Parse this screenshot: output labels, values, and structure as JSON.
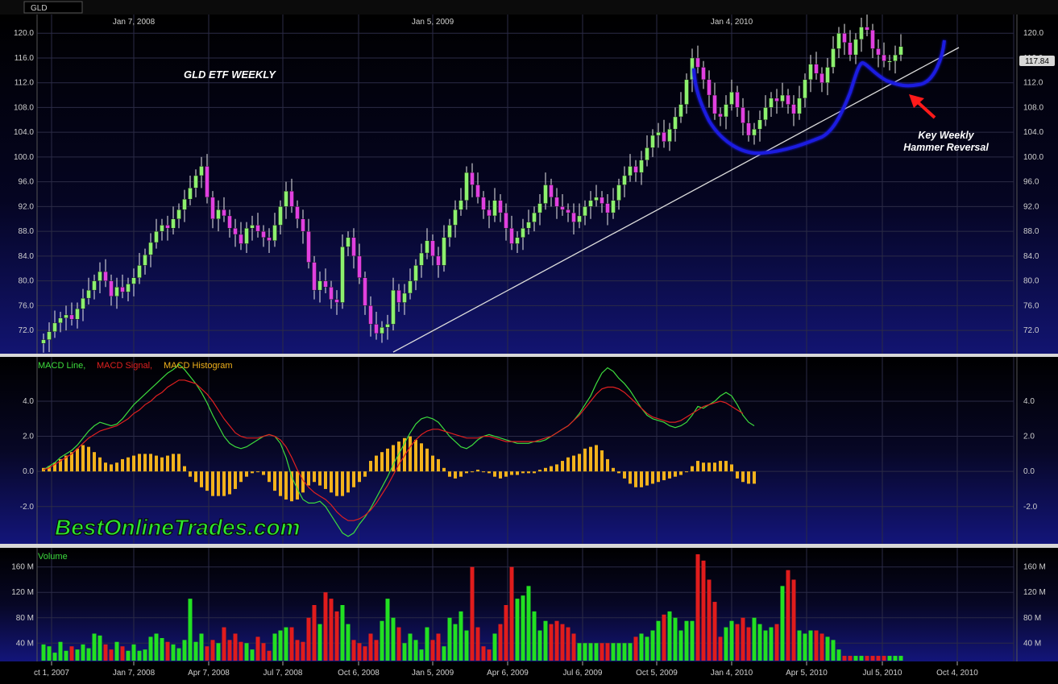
{
  "header": {
    "symbol": "GLD"
  },
  "chart_data": [
    {
      "type": "candlestick",
      "title": "GLD ETF WEEKLY",
      "top_date_labels": [
        "Jan 7, 2008",
        "Jan 5, 2009",
        "Jan 4, 2010"
      ],
      "ylim": [
        68.5,
        122.5
      ],
      "yticks": [
        72.0,
        76.0,
        80.0,
        84.0,
        88.0,
        92.0,
        96.0,
        100.0,
        104.0,
        108.0,
        112.0,
        116.0,
        120.0
      ],
      "last_price_label": "117.84",
      "annotation": [
        "Key Weekly",
        "Hammer Reversal"
      ],
      "grid": true,
      "closes": [
        70.5,
        71.8,
        73.2,
        74.0,
        74.5,
        73.8,
        75.5,
        77.2,
        78.5,
        80.0,
        81.5,
        80.0,
        77.5,
        79.0,
        78.2,
        79.5,
        80.5,
        82.5,
        84.2,
        86.2,
        88.0,
        89.0,
        88.5,
        90.0,
        91.5,
        93.2,
        95.0,
        97.0,
        98.5,
        93.5,
        90.0,
        91.5,
        90.5,
        88.5,
        87.5,
        86.0,
        88.5,
        89.0,
        88.0,
        87.0,
        86.5,
        89.0,
        92.0,
        94.5,
        92.0,
        90.0,
        88.0,
        83.0,
        78.5,
        80.0,
        79.0,
        77.0,
        76.5,
        85.5,
        87.0,
        84.0,
        80.5,
        76.0,
        73.0,
        71.5,
        72.5,
        73.0,
        78.5,
        76.5,
        78.0,
        80.0,
        82.5,
        84.5,
        86.5,
        84.0,
        82.5,
        87.0,
        89.0,
        91.5,
        93.0,
        97.5,
        95.5,
        93.5,
        91.5,
        90.5,
        93.0,
        91.0,
        88.5,
        86.0,
        87.0,
        88.5,
        89.5,
        91.0,
        92.5,
        95.5,
        93.5,
        92.0,
        91.5,
        91.0,
        89.5,
        90.5,
        92.0,
        93.0,
        93.5,
        92.5,
        91.0,
        93.0,
        95.5,
        97.0,
        98.5,
        97.5,
        99.5,
        101.5,
        103.5,
        104.0,
        102.5,
        104.5,
        106.5,
        108.5,
        112.5,
        116.0,
        114.5,
        112.5,
        110.0,
        107.0,
        106.5,
        108.5,
        110.5,
        108.0,
        105.5,
        103.5,
        104.5,
        106.0,
        108.0,
        109.5,
        109.0,
        110.0,
        108.5,
        107.0,
        109.5,
        112.5,
        115.0,
        113.5,
        112.0,
        114.5,
        117.5,
        120.0,
        118.5,
        116.5,
        119.0,
        121.0,
        120.5,
        117.5,
        116.5,
        115.5,
        115.5,
        116.5,
        117.84
      ]
    },
    {
      "type": "line",
      "series": [
        {
          "name": "MACD Line",
          "color": "#3ddc3d",
          "values": [
            0.1,
            0.3,
            0.5,
            0.8,
            1.0,
            1.2,
            1.5,
            1.9,
            2.3,
            2.6,
            2.8,
            2.7,
            2.6,
            2.7,
            3.0,
            3.4,
            3.8,
            4.1,
            4.4,
            4.7,
            5.0,
            5.3,
            5.6,
            5.8,
            6.1,
            5.8,
            5.4,
            5.0,
            4.5,
            3.9,
            3.2,
            2.6,
            2.0,
            1.6,
            1.4,
            1.3,
            1.4,
            1.6,
            1.8,
            2.0,
            2.1,
            2.0,
            1.6,
            0.8,
            -0.3,
            -1.0,
            -1.6,
            -1.8,
            -1.8,
            -1.7,
            -2.0,
            -2.5,
            -3.0,
            -3.5,
            -3.7,
            -3.5,
            -3.0,
            -2.6,
            -2.1,
            -1.5,
            -0.9,
            -0.3,
            0.4,
            1.0,
            1.6,
            2.2,
            2.7,
            3.0,
            3.1,
            3.0,
            2.8,
            2.4,
            2.0,
            1.7,
            1.4,
            1.3,
            1.5,
            1.8,
            2.0,
            2.1,
            2.0,
            1.9,
            1.8,
            1.7,
            1.6,
            1.6,
            1.6,
            1.7,
            1.7,
            1.8,
            2.0,
            2.2,
            2.4,
            2.6,
            2.9,
            3.3,
            3.8,
            4.3,
            5.0,
            5.6,
            5.9,
            5.7,
            5.3,
            5.0,
            4.6,
            4.1,
            3.6,
            3.2,
            3.0,
            2.9,
            2.8,
            2.6,
            2.5,
            2.6,
            2.8,
            3.2,
            3.7,
            3.6,
            3.8,
            4.0,
            4.3,
            4.5,
            4.3,
            3.8,
            3.2,
            2.8,
            2.6
          ]
        },
        {
          "name": "MACD Signal",
          "color": "#e02020",
          "values": [
            0.1,
            0.2,
            0.4,
            0.6,
            0.8,
            1.0,
            1.3,
            1.6,
            1.9,
            2.1,
            2.3,
            2.4,
            2.5,
            2.6,
            2.8,
            3.0,
            3.3,
            3.5,
            3.8,
            4.0,
            4.3,
            4.5,
            4.8,
            5.0,
            5.2,
            5.2,
            5.1,
            5.0,
            4.7,
            4.4,
            4.0,
            3.5,
            3.0,
            2.6,
            2.2,
            2.0,
            1.9,
            1.9,
            1.9,
            2.0,
            2.1,
            2.0,
            1.8,
            1.4,
            0.8,
            0.1,
            -0.5,
            -0.9,
            -1.2,
            -1.4,
            -1.6,
            -1.9,
            -2.3,
            -2.6,
            -2.8,
            -2.8,
            -2.7,
            -2.5,
            -2.2,
            -1.8,
            -1.3,
            -0.8,
            -0.2,
            0.4,
            0.9,
            1.4,
            1.8,
            2.1,
            2.3,
            2.4,
            2.4,
            2.3,
            2.2,
            2.1,
            2.0,
            1.9,
            1.9,
            1.9,
            2.0,
            2.0,
            1.9,
            1.8,
            1.7,
            1.7,
            1.7,
            1.7,
            1.7,
            1.7,
            1.8,
            1.9,
            2.0,
            2.2,
            2.4,
            2.6,
            2.9,
            3.2,
            3.6,
            4.0,
            4.4,
            4.7,
            4.8,
            4.8,
            4.7,
            4.5,
            4.2,
            3.9,
            3.6,
            3.3,
            3.1,
            3.0,
            2.9,
            2.8,
            2.8,
            2.9,
            3.1,
            3.3,
            3.5,
            3.7,
            3.8,
            3.9,
            4.0,
            3.9,
            3.7,
            3.5,
            3.3
          ]
        }
      ],
      "histogram": {
        "name": "MACD Histogram",
        "color": "#f2b21c",
        "values": [
          0.2,
          0.3,
          0.5,
          0.7,
          0.9,
          1.1,
          1.3,
          1.5,
          1.4,
          1.1,
          0.8,
          0.5,
          0.4,
          0.5,
          0.7,
          0.8,
          0.9,
          1.0,
          1.0,
          1.0,
          0.9,
          0.8,
          0.9,
          1.0,
          1.0,
          0.3,
          -0.3,
          -0.6,
          -0.9,
          -1.1,
          -1.4,
          -1.4,
          -1.4,
          -1.3,
          -1.0,
          -0.6,
          -0.3,
          -0.1,
          0.0,
          -0.2,
          -0.6,
          -1.1,
          -1.4,
          -1.6,
          -1.7,
          -1.6,
          -1.2,
          -0.8,
          -0.6,
          -0.8,
          -1.0,
          -1.2,
          -1.4,
          -1.4,
          -1.2,
          -0.9,
          -0.6,
          -0.3,
          0.6,
          0.9,
          1.1,
          1.3,
          1.5,
          1.7,
          1.9,
          2.0,
          1.8,
          1.6,
          1.3,
          0.9,
          0.7,
          0.2,
          -0.3,
          -0.4,
          -0.3,
          -0.1,
          0.0,
          0.1,
          0.0,
          -0.1,
          -0.3,
          -0.4,
          -0.3,
          -0.2,
          -0.2,
          -0.1,
          -0.1,
          -0.1,
          0.1,
          0.2,
          0.3,
          0.4,
          0.6,
          0.8,
          0.9,
          1.0,
          1.3,
          1.4,
          1.5,
          1.2,
          0.7,
          0.2,
          -0.1,
          -0.4,
          -0.7,
          -0.9,
          -0.9,
          -0.8,
          -0.7,
          -0.6,
          -0.5,
          -0.4,
          -0.3,
          -0.2,
          0.0,
          0.3,
          0.6,
          0.5,
          0.5,
          0.5,
          0.6,
          0.6,
          0.4,
          -0.4,
          -0.6,
          -0.7,
          -0.7
        ]
      },
      "legend": [
        "MACD Line,",
        "MACD Signal,",
        "MACD Histogram"
      ],
      "ylim": [
        -3.8,
        6.2
      ],
      "yticks": [
        -2.0,
        0.0,
        2.0,
        4.0
      ],
      "ytick_labels": [
        "-2.0",
        "0.0",
        "2.0",
        "4.0"
      ]
    },
    {
      "type": "bar",
      "legend": "Volume",
      "ylim": [
        15,
        185
      ],
      "yticks": [
        40,
        80,
        120,
        160
      ],
      "ytick_labels": [
        "40 M",
        "80 M",
        "120 M",
        "160 M"
      ],
      "x_labels": [
        "ct 1, 2007",
        "Jan 7, 2008",
        "Apr 7, 2008",
        "Jul 7, 2008",
        "Oct 6, 2008",
        "Jan 5, 2009",
        "Apr 6, 2009",
        "Jul 6, 2009",
        "Oct 5, 2009",
        "Jan 4, 2010",
        "Apr 5, 2010",
        "Jul 5, 2010",
        "Oct 4, 2010"
      ],
      "values": [
        38,
        35,
        25,
        42,
        28,
        35,
        30,
        38,
        32,
        55,
        52,
        38,
        30,
        42,
        35,
        28,
        38,
        28,
        30,
        50,
        55,
        48,
        42,
        38,
        32,
        45,
        110,
        42,
        55,
        35,
        45,
        40,
        65,
        45,
        55,
        42,
        40,
        30,
        50,
        40,
        28,
        55,
        60,
        65,
        65,
        45,
        42,
        80,
        100,
        70,
        120,
        110,
        90,
        100,
        70,
        45,
        40,
        35,
        55,
        45,
        75,
        110,
        80,
        65,
        40,
        55,
        45,
        30,
        65,
        45,
        55,
        35,
        80,
        70,
        90,
        60,
        160,
        65,
        35,
        30,
        55,
        70,
        100,
        160,
        110,
        115,
        130,
        90,
        60,
        75,
        70,
        75,
        70,
        65,
        55,
        40,
        40,
        40,
        40,
        40,
        40,
        40,
        40,
        40,
        40,
        50,
        55,
        50,
        60,
        75,
        85,
        90,
        80,
        60,
        75,
        75,
        180,
        170,
        140,
        105,
        50,
        65,
        75,
        70,
        80,
        65,
        80,
        70,
        60,
        65,
        70,
        130,
        155,
        140,
        60,
        55,
        60,
        60,
        55,
        50,
        45,
        30,
        20,
        20,
        20,
        20,
        20,
        20,
        20,
        20,
        20,
        20,
        20,
        20,
        20,
        20,
        20,
        20,
        20,
        20
      ],
      "colors": "green when the weekly candle closes up, red when it closes down"
    }
  ],
  "watermark": "BestOnlineTrades.com",
  "colors": {
    "up": "#8cf06e",
    "down": "#e040e0",
    "vol_up": "#22e022",
    "vol_down": "#e01c1c",
    "trendline": "#dddddd",
    "cup": "#1a1ad8",
    "arrow": "#ff1a1a",
    "grid": "#2b2b46"
  }
}
